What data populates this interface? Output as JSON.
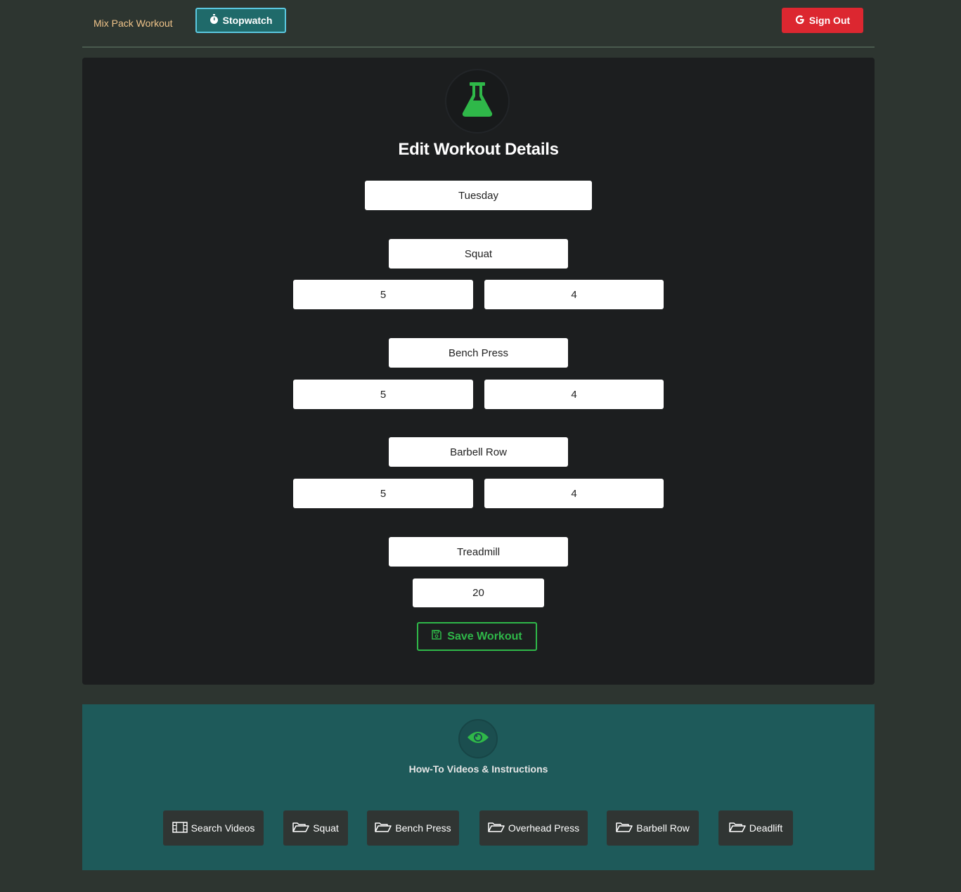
{
  "nav": {
    "brand": "Mix Pack Workout",
    "stopwatch_label": "Stopwatch",
    "signout_label": "Sign Out"
  },
  "form": {
    "title": "Edit Workout Details",
    "day": "Tuesday",
    "exercises": [
      {
        "name": "Squat",
        "sets": "5",
        "reps": "4"
      },
      {
        "name": "Bench Press",
        "sets": "5",
        "reps": "4"
      },
      {
        "name": "Barbell Row",
        "sets": "5",
        "reps": "4"
      }
    ],
    "cardio": {
      "name": "Treadmill",
      "minutes": "20"
    },
    "save_label": "Save Workout"
  },
  "videos": {
    "title": "How-To Videos & Instructions",
    "buttons": [
      {
        "label": "Search Videos",
        "icon": "film-icon"
      },
      {
        "label": "Squat",
        "icon": "folder-open-icon"
      },
      {
        "label": "Bench Press",
        "icon": "folder-open-icon"
      },
      {
        "label": "Overhead Press",
        "icon": "folder-open-icon"
      },
      {
        "label": "Barbell Row",
        "icon": "folder-open-icon"
      },
      {
        "label": "Deadlift",
        "icon": "folder-open-icon"
      }
    ]
  },
  "colors": {
    "background": "#2d3530",
    "card": "#1c1e1f",
    "accent_green": "#2fb849",
    "stopwatch": "#1f6a6a",
    "signout": "#dc2730",
    "videos_bg": "#1e5a5a",
    "brand": "#f0c48a"
  }
}
